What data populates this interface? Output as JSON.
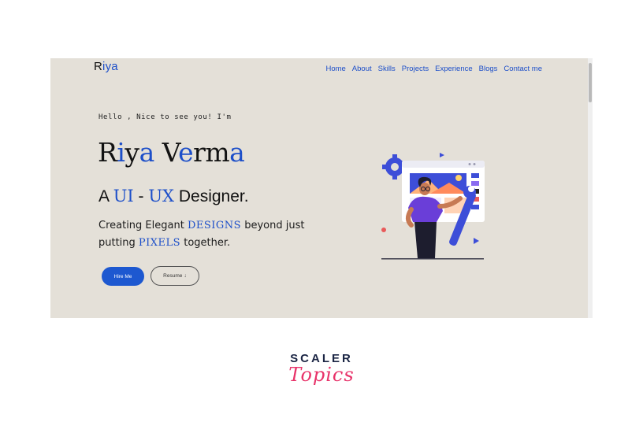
{
  "header": {
    "logo_first": "R",
    "logo_accent": "iya",
    "nav": [
      "Home",
      "About",
      "Skills",
      "Projects",
      "Experience",
      "Blogs",
      "Contact me"
    ]
  },
  "hero": {
    "greeting": "Hello , Nice to see you! I'm",
    "name_parts": [
      "R",
      "i",
      "y",
      "a",
      " V",
      "e",
      "rm",
      "a"
    ],
    "role_prefix": "A ",
    "role_ui": "UI",
    "role_dash": " - ",
    "role_ux": "UX",
    "role_suffix": " Designer.",
    "tag_1": "Creating Elegant ",
    "tag_designs": "DESIGNS",
    "tag_2": " beyond just putting ",
    "tag_pixels": "PIXELS",
    "tag_3": " together.",
    "hire_label": "Hire Me",
    "resume_label": "Resume",
    "resume_icon": "↓"
  },
  "brand": {
    "top": "SCALER",
    "bottom": "Topics"
  },
  "colors": {
    "accent": "#1d4fc9",
    "background": "#e4e0d8",
    "brand_pink": "#e8336a",
    "brand_navy": "#1b2544"
  },
  "icons": {
    "illustration": "designer-illustration",
    "download": "download-icon"
  }
}
